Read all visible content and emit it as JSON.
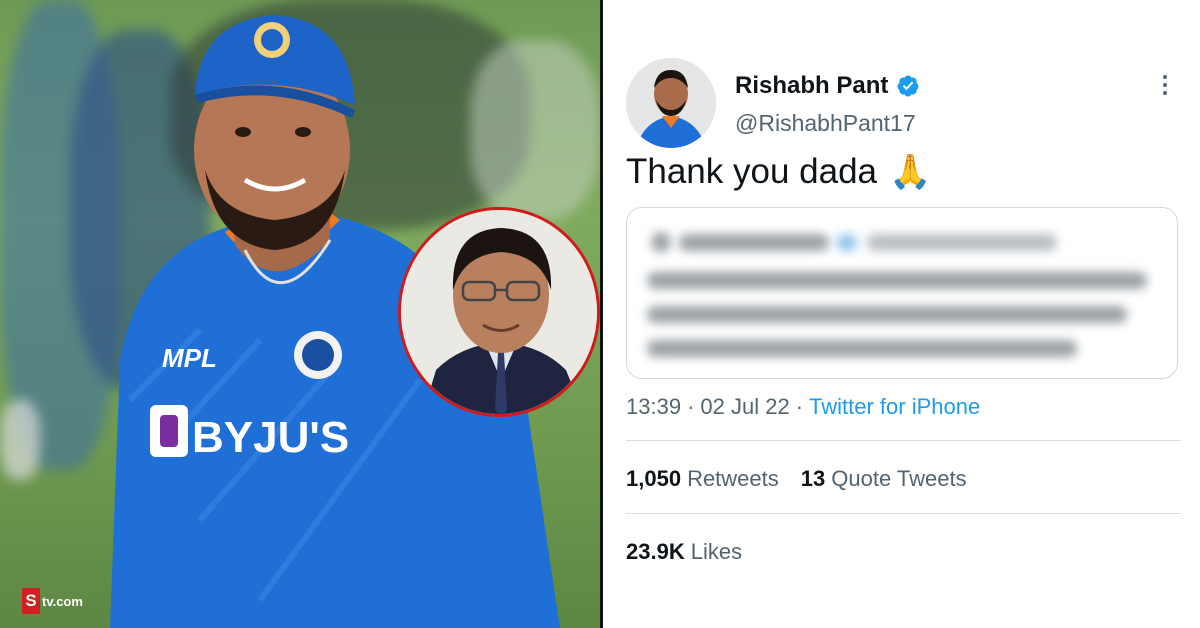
{
  "watermark": {
    "logo_letter": "S",
    "text": "tv.com"
  },
  "tweet": {
    "name": "Rishabh Pant",
    "handle": "@RishabhPant17",
    "text": "Thank you dada",
    "emoji": "🙏",
    "time": "13:39",
    "separator": "·",
    "date": "02 Jul 22",
    "source": "Twitter for iPhone",
    "retweets_count": "1,050",
    "retweets_label": "Retweets",
    "quotes_count": "13",
    "quotes_label": "Quote Tweets",
    "likes_count": "23.9K",
    "likes_label": "Likes"
  },
  "jersey": {
    "sponsor": "BYJU'S",
    "kit": "MPL"
  },
  "colors": {
    "verified": "#1d9bf0",
    "link": "#1d9bf0",
    "muted": "#536471",
    "inset_border": "#d11b1b",
    "jersey": "#1f6fd6"
  },
  "icons": [
    "verified-badge-icon",
    "more-options-icon",
    "folded-hands-emoji"
  ]
}
